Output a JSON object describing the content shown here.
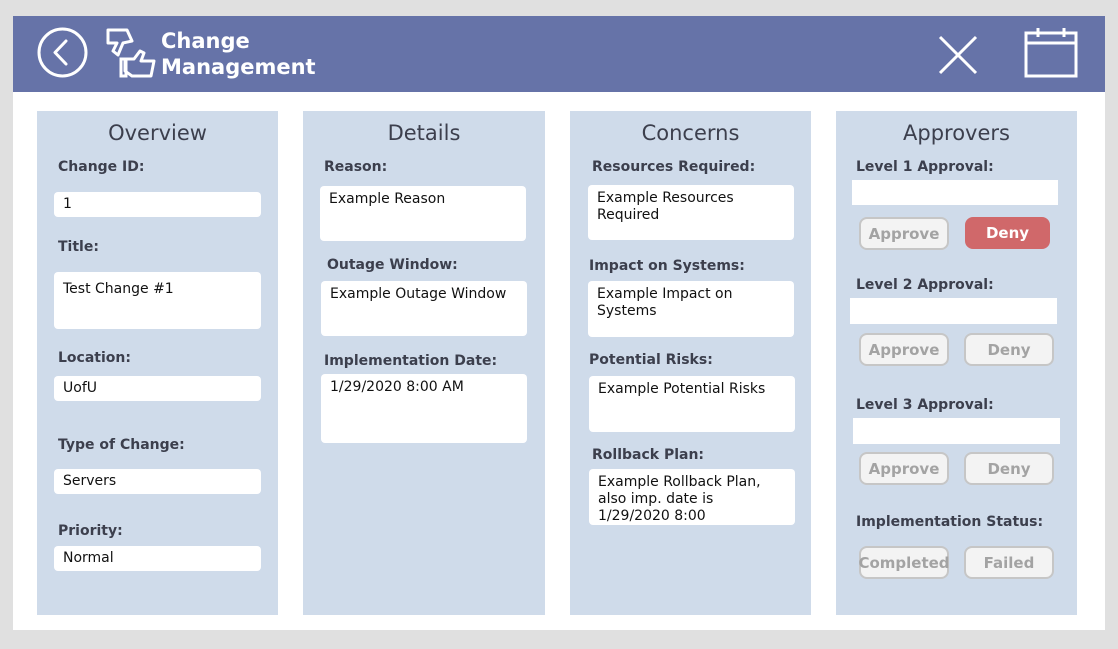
{
  "header": {
    "title_line1": "Change",
    "title_line2": "Management",
    "icons": {
      "back": "back-circle-icon",
      "logo": "thumbs-up-down-icon",
      "close": "close-x-icon",
      "calendar": "calendar-icon"
    }
  },
  "overview": {
    "title": "Overview",
    "change_id_label": "Change ID:",
    "change_id_value": "1",
    "title_label": "Title:",
    "title_value": "Test Change #1",
    "location_label": "Location:",
    "location_value": "UofU",
    "type_label": "Type of Change:",
    "type_value": "Servers",
    "priority_label": "Priority:",
    "priority_value": "Normal"
  },
  "details": {
    "title": "Details",
    "reason_label": "Reason:",
    "reason_value": "Example Reason",
    "outage_label": "Outage Window:",
    "outage_value": "Example Outage Window",
    "impl_date_label": "Implementation Date:",
    "impl_date_value": "1/29/2020 8:00 AM"
  },
  "concerns": {
    "title": "Concerns",
    "resources_label": "Resources Required:",
    "resources_value": "Example Resources Required",
    "impact_label": "Impact on Systems:",
    "impact_value": "Example Impact on Systems",
    "risks_label": "Potential Risks:",
    "risks_value": "Example Potential Risks",
    "rollback_label": "Rollback Plan:",
    "rollback_value": "Example Rollback Plan, also imp. date is 1/29/2020 8:00"
  },
  "approvers": {
    "title": "Approvers",
    "level1_label": "Level 1 Approval:",
    "level1_value": "",
    "level2_label": "Level 2 Approval:",
    "level2_value": "",
    "level3_label": "Level 3 Approval:",
    "level3_value": "",
    "approve_label": "Approve",
    "deny_label": "Deny",
    "status_label": "Implementation Status:",
    "completed_label": "Completed",
    "failed_label": "Failed"
  },
  "colors": {
    "header_bg": "#6673a8",
    "panel_bg": "#cfdbea",
    "deny_active": "#d0686a",
    "app_bg": "#e0e0e0"
  }
}
